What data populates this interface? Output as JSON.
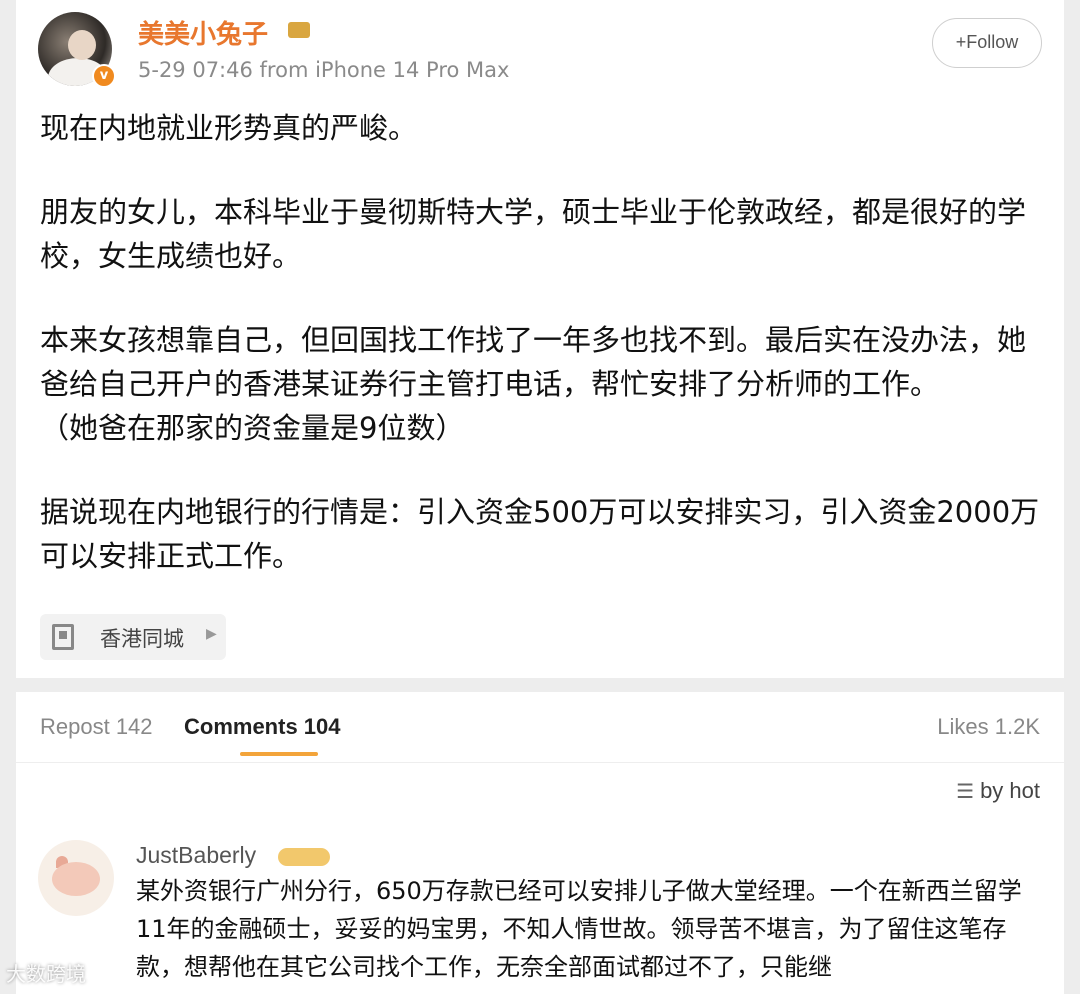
{
  "post": {
    "username": "美美小兔子",
    "meta": "5-29 07:46  from iPhone 14 Pro Max",
    "follow_label": "+Follow",
    "paragraphs": [
      "现在内地就业形势真的严峻。",
      "朋友的女儿，本科毕业于曼彻斯特大学，硕士毕业于伦敦政经，都是很好的学校，女生成绩也好。",
      "本来女孩想靠自己，但回国找工作找了一年多也找不到。最后实在没办法，她爸给自己开户的香港某证券行主管打电话，帮忙安排了分析师的工作。",
      "（她爸在那家的资金量是9位数）",
      "据说现在内地银行的行情是：引入资金500万可以安排实习，引入资金2000万可以安排正式工作。"
    ],
    "location": "香港同城",
    "icons": {
      "avatar": "user-avatar",
      "verified": "verified-badge-icon",
      "crown": "crown-icon",
      "location": "building-icon",
      "arrow": "chevron-right-icon"
    }
  },
  "tabs": {
    "repost": "Repost 142",
    "comments": "Comments 104",
    "likes": "Likes 1.2K",
    "sort": "by hot"
  },
  "comment": {
    "username": "JustBaberly",
    "text": "某外资银行广州分行，650万存款已经可以安排儿子做大堂经理。一个在新西兰留学11年的金融硕士，妥妥的妈宝男，不知人情世故。领导苦不堪言，为了留住这笔存款，想帮他在其它公司找个工作，无奈全部面试都过不了，只能继"
  },
  "watermark": "大数跨境",
  "colors": {
    "username": "#e8772e",
    "accent": "#f3a43a",
    "verified": "#f08a1f"
  }
}
